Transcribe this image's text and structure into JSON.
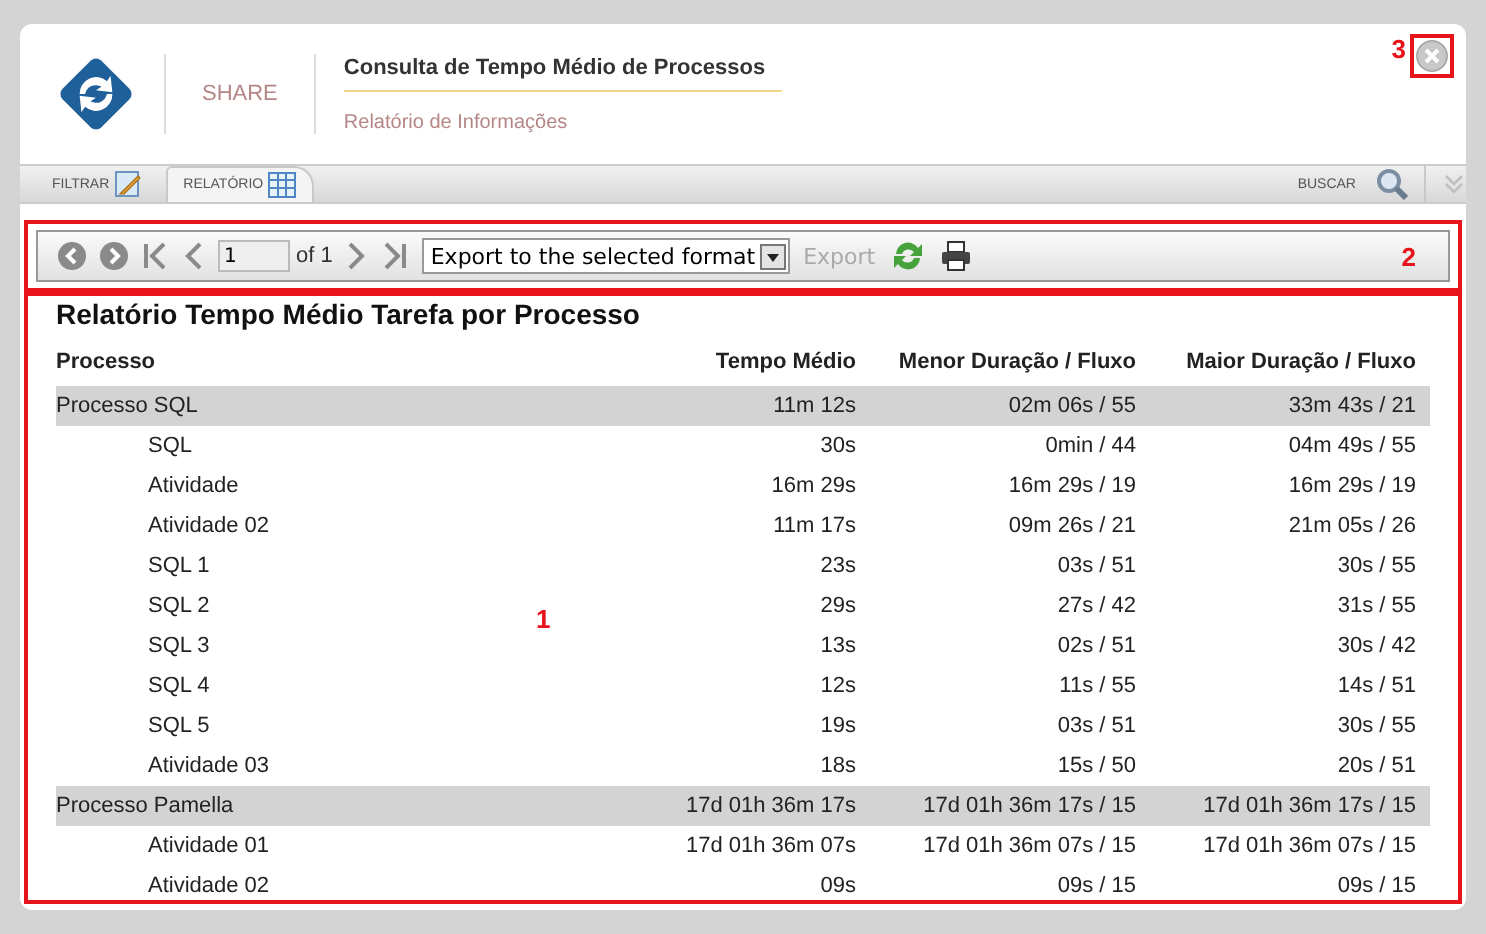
{
  "header": {
    "brand": "SHARE",
    "title": "Consulta de Tempo Médio de Processos",
    "subtitle": "Relatório de Informações"
  },
  "tabs": [
    {
      "label": "FILTRAR",
      "selected": false
    },
    {
      "label": "RELATÓRIO",
      "selected": true
    }
  ],
  "search_label": "BUSCAR",
  "toolbar": {
    "page": "1",
    "page_count": "of 1",
    "export_format": "Export to the selected format",
    "export_label": "Export",
    "export_disabled": true
  },
  "report": {
    "title": "Relatório Tempo Médio Tarefa por Processo",
    "columns": [
      "Processo",
      "Tempo Médio",
      "Menor Duração / Fluxo",
      "Maior Duração / Fluxo"
    ],
    "rows": [
      {
        "name": "Processo SQL",
        "avg": "11m 12s",
        "min": "02m 06s / 55",
        "max": "33m 43s / 21",
        "children": [
          {
            "name": "SQL",
            "avg": "30s",
            "min": "0min / 44",
            "max": "04m 49s / 55"
          },
          {
            "name": "Atividade",
            "avg": "16m 29s",
            "min": "16m 29s / 19",
            "max": "16m 29s / 19"
          },
          {
            "name": "Atividade 02",
            "avg": "11m 17s",
            "min": "09m 26s / 21",
            "max": "21m 05s / 26"
          },
          {
            "name": "SQL 1",
            "avg": "23s",
            "min": "03s / 51",
            "max": "30s / 55"
          },
          {
            "name": "SQL 2",
            "avg": "29s",
            "min": "27s / 42",
            "max": "31s / 55"
          },
          {
            "name": "SQL 3",
            "avg": "13s",
            "min": "02s / 51",
            "max": "30s / 42"
          },
          {
            "name": "SQL 4",
            "avg": "12s",
            "min": "11s / 55",
            "max": "14s / 51"
          },
          {
            "name": "SQL 5",
            "avg": "19s",
            "min": "03s / 51",
            "max": "30s / 55"
          },
          {
            "name": "Atividade 03",
            "avg": "18s",
            "min": "15s / 50",
            "max": "20s / 51"
          }
        ]
      },
      {
        "name": "Processo Pamella",
        "avg": "17d 01h 36m 17s",
        "min": "17d 01h 36m 17s / 15",
        "max": "17d 01h 36m 17s / 15",
        "children": [
          {
            "name": "Atividade 01",
            "avg": "17d 01h 36m 07s",
            "min": "17d 01h 36m 07s / 15",
            "max": "17d 01h 36m 07s / 15"
          },
          {
            "name": "Atividade 02",
            "avg": "09s",
            "min": "09s / 15",
            "max": "09s / 15"
          }
        ]
      }
    ]
  },
  "annotations": [
    {
      "label": "1"
    },
    {
      "label": "2"
    },
    {
      "label": "3"
    }
  ]
}
